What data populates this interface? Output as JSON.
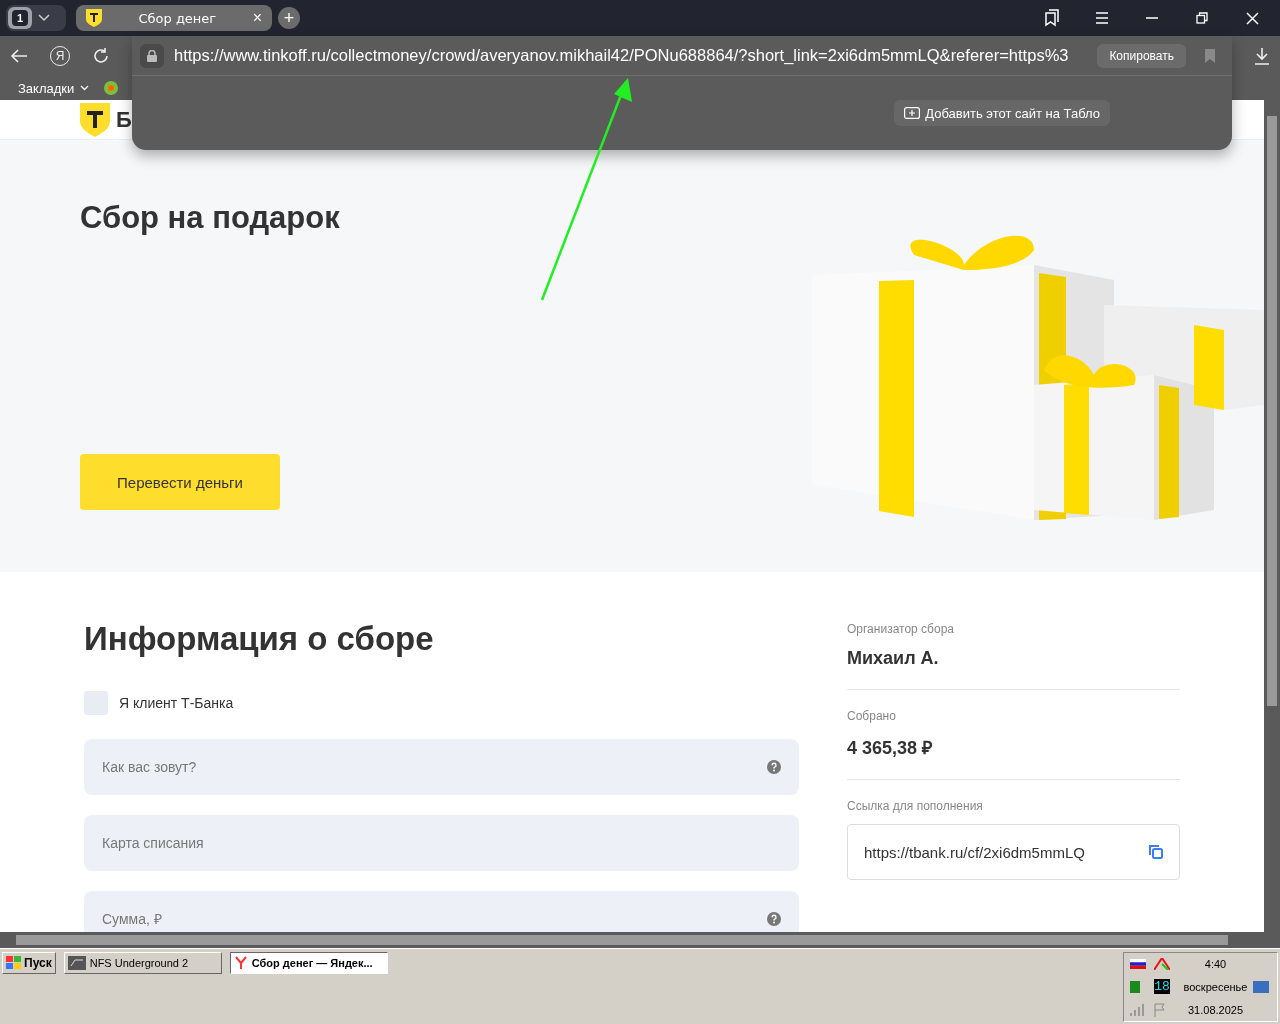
{
  "browser": {
    "tab_count": "1",
    "tabs": [
      {
        "title": "Сбор денег",
        "selected": true,
        "close": "×"
      }
    ],
    "new_tab": "+",
    "yandex_button": "Я",
    "url": "https://www.tinkoff.ru/collectmoney/crowd/averyanov.mikhail42/PONu688864/?short_link=2xi6dm5mmLQ&referer=https%3",
    "copy_button": "Копировать",
    "add_to_tablo": "Добавить этот сайт на Табло",
    "bookmarks_label": "Закладки"
  },
  "page": {
    "logo_text": "Б",
    "hero": {
      "title": "Сбор на подарок",
      "button": "Перевести деньги"
    },
    "info": {
      "title": "Информация о сборе",
      "client_checkbox": {
        "label": "Я клиент Т-Банка",
        "checked": false
      },
      "fields": [
        {
          "placeholder": "Как вас зовут?",
          "help": true
        },
        {
          "placeholder": "Карта списания",
          "help": false
        },
        {
          "placeholder": "Сумма, ₽",
          "help": true
        }
      ],
      "organizer_label": "Организатор сбора",
      "organizer": "Михаил А.",
      "collected_label": "Собрано",
      "collected": "4 365,38 ₽",
      "link_label": "Ссылка для пополнения",
      "link": "https://tbank.ru/cf/2xi6dm5mmLQ"
    }
  },
  "taskbar": {
    "start": "Пуск",
    "tasks": [
      {
        "title": "NFS Underground 2",
        "selected": false
      },
      {
        "title": "Сбор денег — Яндек...",
        "selected": true
      }
    ],
    "tray": {
      "time": "4:40",
      "day": "воскресенье",
      "date": "31.08.2025",
      "counter": "18"
    }
  }
}
